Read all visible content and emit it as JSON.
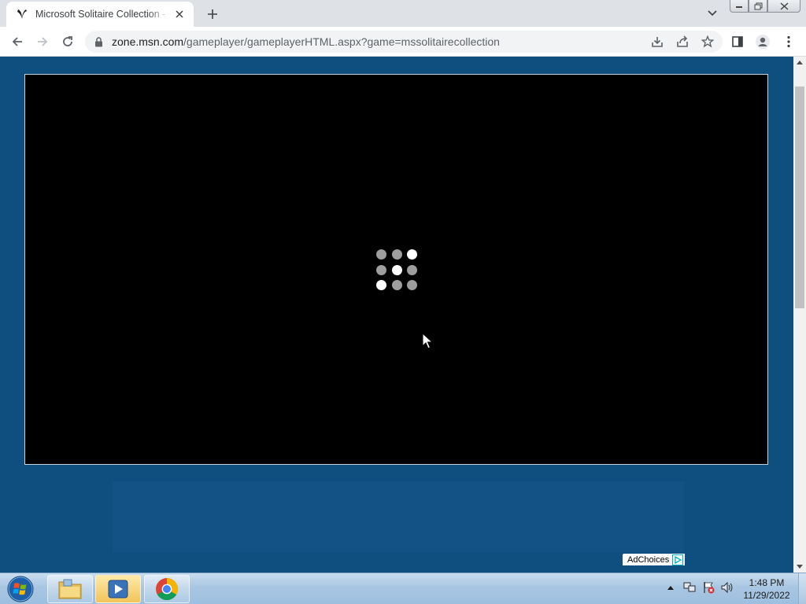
{
  "browser": {
    "tab": {
      "title": "Microsoft Solitaire Collection - MSN Games",
      "favicon": "msn-butterfly-icon"
    },
    "address_bar": {
      "host": "zone.msn.com",
      "path": "/gameplayer/gameplayerHTML.aspx?game=mssolitairecollection"
    },
    "icons": {
      "back": "back-arrow-icon",
      "forward": "forward-arrow-icon",
      "reload": "reload-icon",
      "lock": "lock-icon",
      "install": "install-app-icon",
      "share": "share-icon",
      "bookmark": "star-icon",
      "side_panel": "side-panel-icon",
      "profile": "profile-icon",
      "menu": "kebab-menu-icon"
    }
  },
  "page": {
    "game": {
      "state": "loading",
      "spinner_bright_dots": [
        2,
        4,
        6
      ]
    },
    "ad": {
      "label": "AdChoices"
    }
  },
  "taskbar": {
    "apps": [
      "windows-explorer-icon",
      "media-player-icon",
      "chrome-icon"
    ],
    "clock": {
      "time": "1:48 PM",
      "date": "11/29/2022"
    }
  },
  "colors": {
    "page_background": "#0f4f80",
    "game_background": "#000000",
    "tab_strip": "#dee1e6"
  }
}
